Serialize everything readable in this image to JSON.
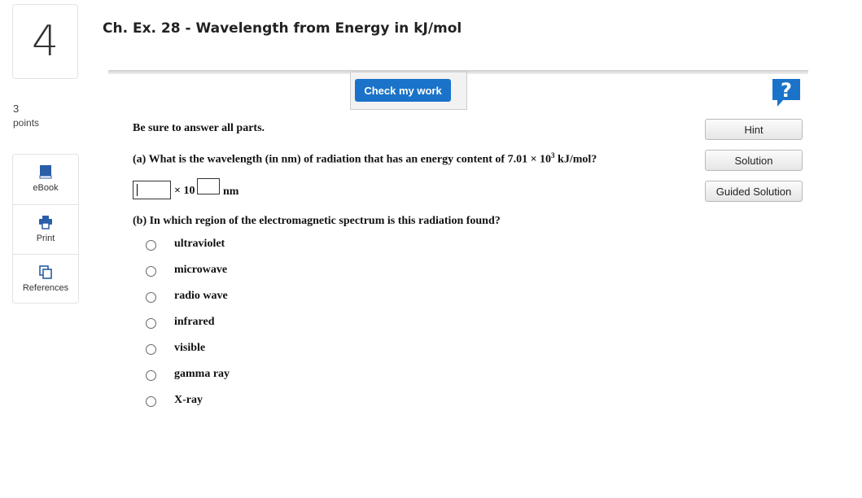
{
  "question": {
    "number": "4",
    "points_value": "3",
    "points_label": "points",
    "title": "Ch. Ex. 28 - Wavelength from Energy in kJ/mol"
  },
  "tools": [
    {
      "label": "eBook",
      "icon": "book-icon"
    },
    {
      "label": "Print",
      "icon": "printer-icon"
    },
    {
      "label": "References",
      "icon": "references-icon"
    }
  ],
  "toolbar": {
    "check_label": "Check my work",
    "help_icon": "question-mark-icon"
  },
  "side_buttons": {
    "hint": "Hint",
    "solution": "Solution",
    "guided": "Guided Solution"
  },
  "content": {
    "instruction": "Be sure to answer all parts.",
    "part_a": {
      "prefix": "(a) What is the wavelength (in nm) of radiation that has an energy content of 7.01 × 10",
      "exponent": "3",
      "suffix": " kJ/mol?",
      "answer_value": "",
      "times_ten": "× 10",
      "exponent_value": "",
      "unit": "nm"
    },
    "part_b": {
      "question": "(b) In which region of the electromagnetic spectrum is this radiation found?",
      "options": [
        "ultraviolet",
        "microwave",
        "radio wave",
        "infrared",
        "visible",
        "gamma ray",
        "X-ray"
      ]
    }
  },
  "colors": {
    "accent": "#1a73c9",
    "help": "#1a73c9"
  }
}
